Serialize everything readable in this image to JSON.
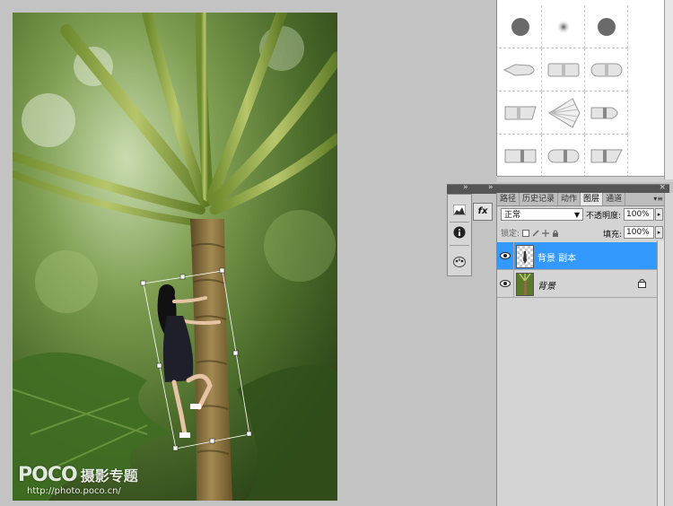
{
  "watermark": {
    "logo": "POCO",
    "title": "摄影专题",
    "url": "http://photo.poco.cn/"
  },
  "layers_panel": {
    "tabs": [
      "路径",
      "历史记录",
      "动作",
      "图层",
      "通道"
    ],
    "active_tab": "图层",
    "blend_mode": "正常",
    "opacity_label": "不透明度:",
    "opacity_value": "100%",
    "lock_label": "锁定:",
    "fill_label": "填充:",
    "fill_value": "100%",
    "layers": [
      {
        "name": "背景 副本",
        "selected": true,
        "visible": true,
        "locked": false
      },
      {
        "name": "背景",
        "selected": false,
        "visible": true,
        "locked": true
      }
    ]
  },
  "mini_tools": {
    "fx_label": "fx"
  },
  "icons": [
    "histogram-icon",
    "info-icon",
    "palette-icon",
    "eye-icon",
    "lock-icon",
    "panel-menu-icon",
    "collapse-chevron-icon",
    "close-icon"
  ],
  "colors": {
    "selection": "#3399ff",
    "panel": "#d4d4d4",
    "workspace": "#c3c3c3"
  }
}
